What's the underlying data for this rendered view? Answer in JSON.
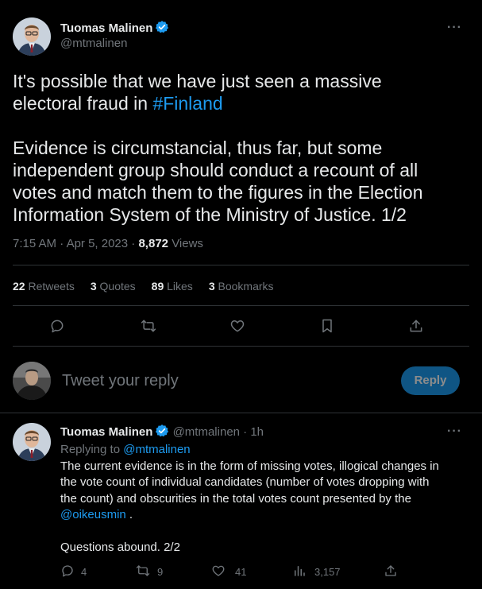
{
  "main_tweet": {
    "author_name": "Tuomas Malinen",
    "author_handle": "@mtmalinen",
    "text_line1_part1": "It's possible that we have just seen a massive",
    "text_line2_part1": "electoral fraud in ",
    "hashtag": "#Finland",
    "text_paragraph2_line1": "Evidence is circumstancial, thus far, but some",
    "text_paragraph2_line2": "independent group should conduct a recount of all",
    "text_paragraph2_line3": "votes and match them to the figures in the Election",
    "text_paragraph2_line4": "Information System of the Ministry of Justice. 1/2",
    "time": "7:15 AM",
    "separator": "·",
    "date": "Apr 5, 2023",
    "views_count": "8,872",
    "views_label": "Views",
    "stats": {
      "retweets_count": "22",
      "retweets_label": "Retweets",
      "quotes_count": "3",
      "quotes_label": "Quotes",
      "likes_count": "89",
      "likes_label": "Likes",
      "bookmarks_count": "3",
      "bookmarks_label": "Bookmarks"
    },
    "actions": [
      "reply-icon",
      "retweet-icon",
      "like-icon",
      "bookmark-icon",
      "share-icon"
    ]
  },
  "composer": {
    "placeholder": "Tweet your reply",
    "reply_button_label": "Reply"
  },
  "reply_tweet": {
    "author_name": "Tuomas Malinen",
    "author_handle": "@mtmalinen",
    "separator": "·",
    "timestamp": "1h",
    "replying_to_label": "Replying to ",
    "replying_to_handle": "@mtmalinen",
    "text_line1": "The current evidence is in the form of missing votes, illogical changes in",
    "text_line2": "the vote count of individual candidates (number of votes dropping with",
    "text_line3": "the count) and obscurities in the total votes count presented by the",
    "mention": "@oikeusmin",
    "mention_suffix": " .",
    "text_final": "Questions abound. 2/2",
    "reply_count": "4",
    "retweet_count": "9",
    "like_count": "41",
    "views_count": "3,157"
  },
  "colors": {
    "background": "#000000",
    "text": "#e7e9ea",
    "muted": "#71767b",
    "accent": "#1d9bf0",
    "divider": "#2f3336"
  }
}
